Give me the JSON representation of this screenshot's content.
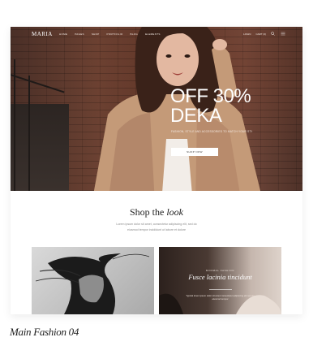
{
  "nav": {
    "logo": "MARIA",
    "links": [
      "HOME",
      "PAGES",
      "SHOP",
      "PORTFOLIO",
      "BLOG",
      "ELEMENTS"
    ],
    "right_links": [
      "LOGIN",
      "CART (0)"
    ]
  },
  "hero": {
    "title_line1": "OFF 30%",
    "title_line2": "DEKA",
    "subtitle": "FASHION, STYLE AND ACCESSORIES TO MATCH YOUR STYLE",
    "button_label": "SHOP NOW"
  },
  "shop": {
    "title_plain": "Shop the",
    "title_italic": "look",
    "description_line1": "Lorem ipsum dolor sit amet, consectetur adipiscing elit, sed do",
    "description_line2": "eiusmod tempor incididunt ut labore et dolore"
  },
  "tiles": {
    "right_kicker": "MINIMAL FASHION",
    "right_heading": "Fusce lacinia tincidunt",
    "right_text": "Typical lorem ipsum dolor sit amet consectetur adipiscing elit sed do eiusmod tempor"
  },
  "caption": "Main Fashion 04",
  "colors": {
    "hero_bg": "#5a3428",
    "jacket": "#c49a78",
    "hair": "#3a2219",
    "text_dark": "#1e1e1e",
    "text_muted": "#8a8a8a"
  },
  "icons": [
    "search-icon",
    "menu-icon"
  ]
}
